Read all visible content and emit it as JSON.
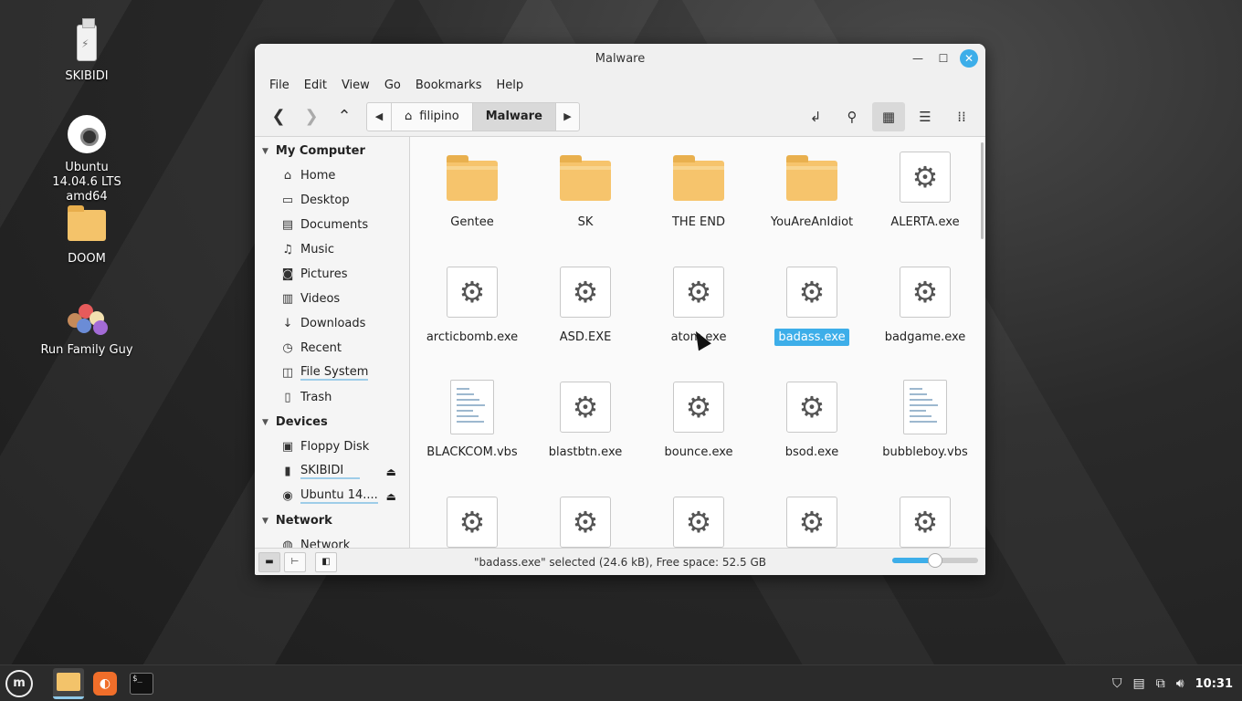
{
  "desktop": {
    "icons": [
      {
        "label": "SKIBIDI"
      },
      {
        "label": "Ubuntu 14.04.6 LTS amd64"
      },
      {
        "label": "DOOM"
      },
      {
        "label": "Run Family Guy"
      }
    ]
  },
  "window": {
    "title": "Malware",
    "menu": [
      "File",
      "Edit",
      "View",
      "Go",
      "Bookmarks",
      "Help"
    ],
    "path": [
      "filipino",
      "Malware"
    ]
  },
  "sidebar": {
    "my_computer": "My Computer",
    "places": [
      "Home",
      "Desktop",
      "Documents",
      "Music",
      "Pictures",
      "Videos",
      "Downloads",
      "Recent",
      "File System",
      "Trash"
    ],
    "devices_head": "Devices",
    "devices": [
      "Floppy Disk",
      "SKIBIDI",
      "Ubuntu 14...."
    ],
    "network_head": "Network",
    "network": [
      "Network"
    ]
  },
  "files": [
    {
      "name": "Gentee",
      "type": "folder"
    },
    {
      "name": "SK",
      "type": "folder"
    },
    {
      "name": "THE END",
      "type": "folder"
    },
    {
      "name": "YouAreAnIdiot",
      "type": "folder"
    },
    {
      "name": "ALERTA.exe",
      "type": "exe"
    },
    {
      "name": "arcticbomb.exe",
      "type": "exe"
    },
    {
      "name": "ASD.EXE",
      "type": "exe"
    },
    {
      "name": "atom.exe",
      "type": "exe"
    },
    {
      "name": "badass.exe",
      "type": "exe",
      "selected": true
    },
    {
      "name": "badgame.exe",
      "type": "exe"
    },
    {
      "name": "BLACKCOM.vbs",
      "type": "doc"
    },
    {
      "name": "blastbtn.exe",
      "type": "exe"
    },
    {
      "name": "bounce.exe",
      "type": "exe"
    },
    {
      "name": "bsod.exe",
      "type": "exe"
    },
    {
      "name": "bubbleboy.vbs",
      "type": "doc"
    },
    {
      "name": "",
      "type": "exe"
    },
    {
      "name": "",
      "type": "exe"
    },
    {
      "name": "",
      "type": "exe"
    },
    {
      "name": "",
      "type": "exe"
    },
    {
      "name": "",
      "type": "exe"
    }
  ],
  "status": {
    "text": "\"badass.exe\" selected (24.6 kB), Free space: 52.5 GB",
    "zoom_fraction": 0.5
  },
  "taskbar": {
    "clock": "10:31"
  }
}
